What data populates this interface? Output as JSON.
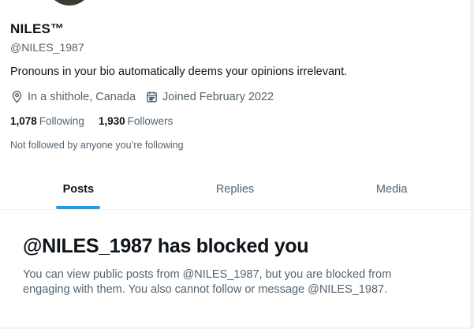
{
  "profile": {
    "display_name": "NILES™",
    "handle": "@NILES_1987",
    "bio": "Pronouns in your bio automatically deems your opinions irrelevant.",
    "location": "In a shithole, Canada",
    "joined": "Joined February 2022",
    "location_icon": "location-pin-icon",
    "calendar_icon": "calendar-icon",
    "following_count": "1,078",
    "following_label": "Following",
    "followers_count": "1,930",
    "followers_label": "Followers",
    "followed_note": "Not followed by anyone you’re following"
  },
  "tabs": [
    {
      "label": "Posts",
      "active": true
    },
    {
      "label": "Replies",
      "active": false
    },
    {
      "label": "Media",
      "active": false
    }
  ],
  "blocked": {
    "title": "@NILES_1987 has blocked you",
    "message": "You can view public posts from @NILES_1987, but you are blocked from engaging with them. You also cannot follow or message @NILES_1987."
  },
  "colors": {
    "accent": "#1d9bf0",
    "text_primary": "#0f1419",
    "text_secondary": "#536471",
    "border": "#eff3f4"
  }
}
